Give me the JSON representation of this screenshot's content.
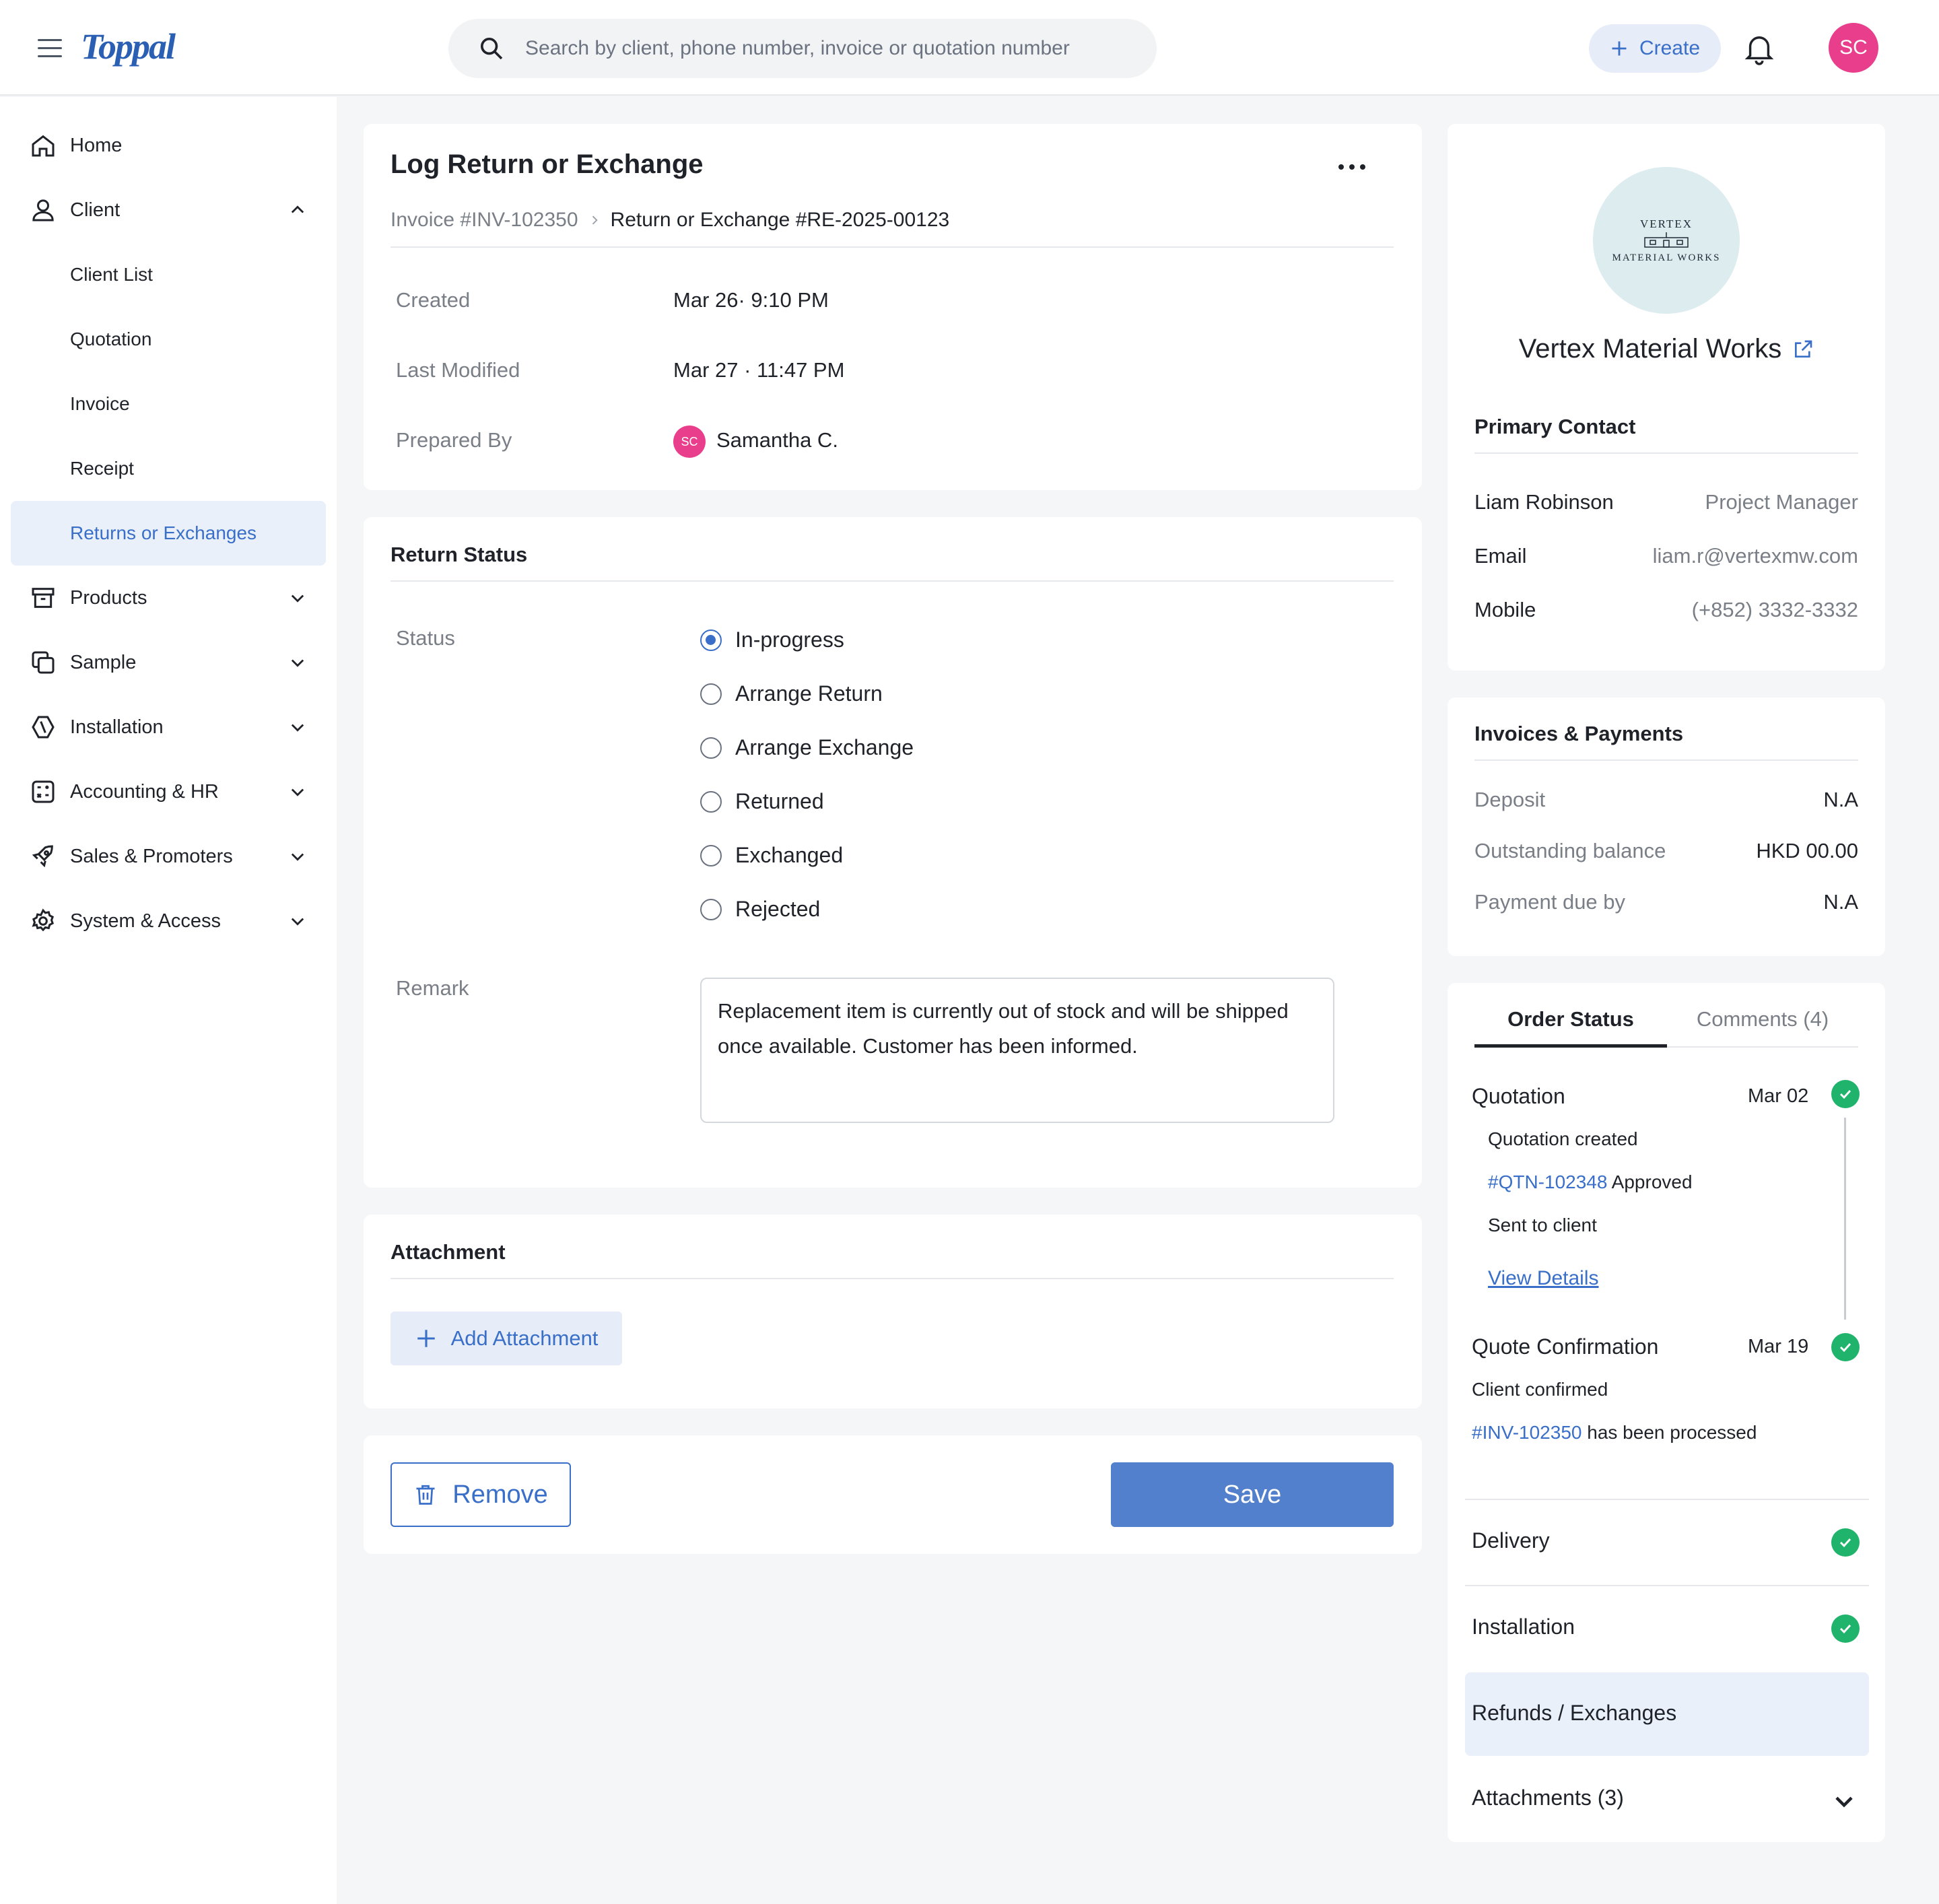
{
  "app": {
    "logo_text": "Toppal"
  },
  "header": {
    "search_placeholder": "Search by client, phone number, invoice or quotation number",
    "create_label": "Create",
    "avatar_initials": "SC"
  },
  "sidebar": {
    "home": "Home",
    "client": "Client",
    "client_sub": [
      "Client List",
      "Quotation",
      "Invoice",
      "Receipt",
      "Returns or Exchanges"
    ],
    "products": "Products",
    "sample": "Sample",
    "installation": "Installation",
    "accounting": "Accounting & HR",
    "sales": "Sales & Promoters",
    "system": "System & Access"
  },
  "main": {
    "title": "Log Return or Exchange",
    "breadcrumb_parent": "Invoice #INV-102350",
    "breadcrumb_current": "Return or Exchange #RE-2025-00123",
    "meta": {
      "created_label": "Created",
      "created_value": "Mar 26· 9:10 PM",
      "modified_label": "Last Modified",
      "modified_value": "Mar 27 · 11:47 PM",
      "prepared_label": "Prepared By",
      "prepared_initials": "SC",
      "prepared_value": "Samantha C."
    },
    "return_status": {
      "title": "Return Status",
      "status_label": "Status",
      "options": [
        "In-progress",
        "Arrange Return",
        "Arrange Exchange",
        "Returned",
        "Exchanged",
        "Rejected"
      ],
      "selected": "In-progress",
      "remark_label": "Remark",
      "remark_value": "Replacement item is currently out of stock and will be shipped once available. Customer has been informed."
    },
    "attachment": {
      "title": "Attachment",
      "add_label": "Add Attachment"
    },
    "actions": {
      "remove": "Remove",
      "save": "Save"
    }
  },
  "client_card": {
    "logo_line1": "VERTEX",
    "logo_line2": "MATERIAL WORKS",
    "name": "Vertex Material Works",
    "primary_contact_title": "Primary Contact",
    "contact_name": "Liam Robinson",
    "contact_role": "Project Manager",
    "email_label": "Email",
    "email_value": "liam.r@vertexmw.com",
    "mobile_label": "Mobile",
    "mobile_value": "(+852) 3332-3332"
  },
  "payments": {
    "title": "Invoices & Payments",
    "deposit_label": "Deposit",
    "deposit_value": "N.A",
    "outstanding_label": "Outstanding balance",
    "outstanding_value": "HKD 00.00",
    "due_label": "Payment due by",
    "due_value": "N.A"
  },
  "order_status": {
    "tab_active": "Order Status",
    "tab_comments": "Comments (4)",
    "quotation": {
      "title": "Quotation",
      "date": "Mar 02",
      "line1": "Quotation created",
      "line2_link": "#QTN-102348",
      "line2_text": " Approved",
      "line3": "Sent to client",
      "view_details": "View Details"
    },
    "confirmation": {
      "title": "Quote Confirmation",
      "date": "Mar 19",
      "line1": "Client confirmed",
      "line2_link": "#INV-102350",
      "line2_text": " has been processed"
    },
    "delivery": "Delivery",
    "installation": "Installation",
    "refunds": "Refunds / Exchanges",
    "attachments": "Attachments (3)"
  },
  "colors": {
    "accent": "#3a6fc9",
    "success": "#1fb36b",
    "avatar": "#e83e8c"
  }
}
